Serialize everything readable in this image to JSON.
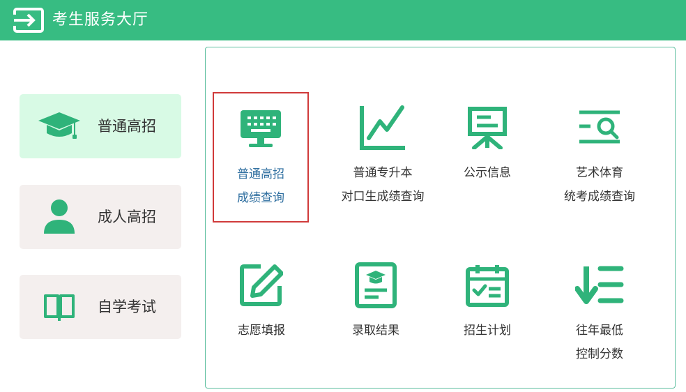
{
  "header": {
    "title": "考生服务大厅",
    "icon": "exit-icon",
    "bg_color": "#37bc82"
  },
  "sidebar": {
    "items": [
      {
        "label": "普通高招",
        "icon": "graduation-cap-icon",
        "active": true
      },
      {
        "label": "成人高招",
        "icon": "person-icon",
        "active": false
      },
      {
        "label": "自学考试",
        "icon": "open-book-icon",
        "active": false
      }
    ]
  },
  "services": [
    {
      "line1": "普通高招",
      "line2": "成绩查询",
      "icon": "monitor-icon",
      "selected": true
    },
    {
      "line1": "普通专升本",
      "line2": "对口生成绩查询",
      "icon": "line-chart-icon",
      "selected": false
    },
    {
      "line1": "公示信息",
      "line2": "",
      "icon": "notice-board-icon",
      "selected": false
    },
    {
      "line1": "艺术体育",
      "line2": "统考成绩查询",
      "icon": "list-search-icon",
      "selected": false
    },
    {
      "line1": "志愿填报",
      "line2": "",
      "icon": "edit-icon",
      "selected": false
    },
    {
      "line1": "录取结果",
      "line2": "",
      "icon": "admission-letter-icon",
      "selected": false
    },
    {
      "line1": "招生计划",
      "line2": "",
      "icon": "calendar-check-icon",
      "selected": false
    },
    {
      "line1": "往年最低",
      "line2": "控制分数",
      "icon": "sort-descending-icon",
      "selected": false
    }
  ],
  "colors": {
    "accent": "#37bc82",
    "icon": "#2fb37a",
    "selected_border": "#d03a3a",
    "selected_text": "#2f6fa0"
  }
}
